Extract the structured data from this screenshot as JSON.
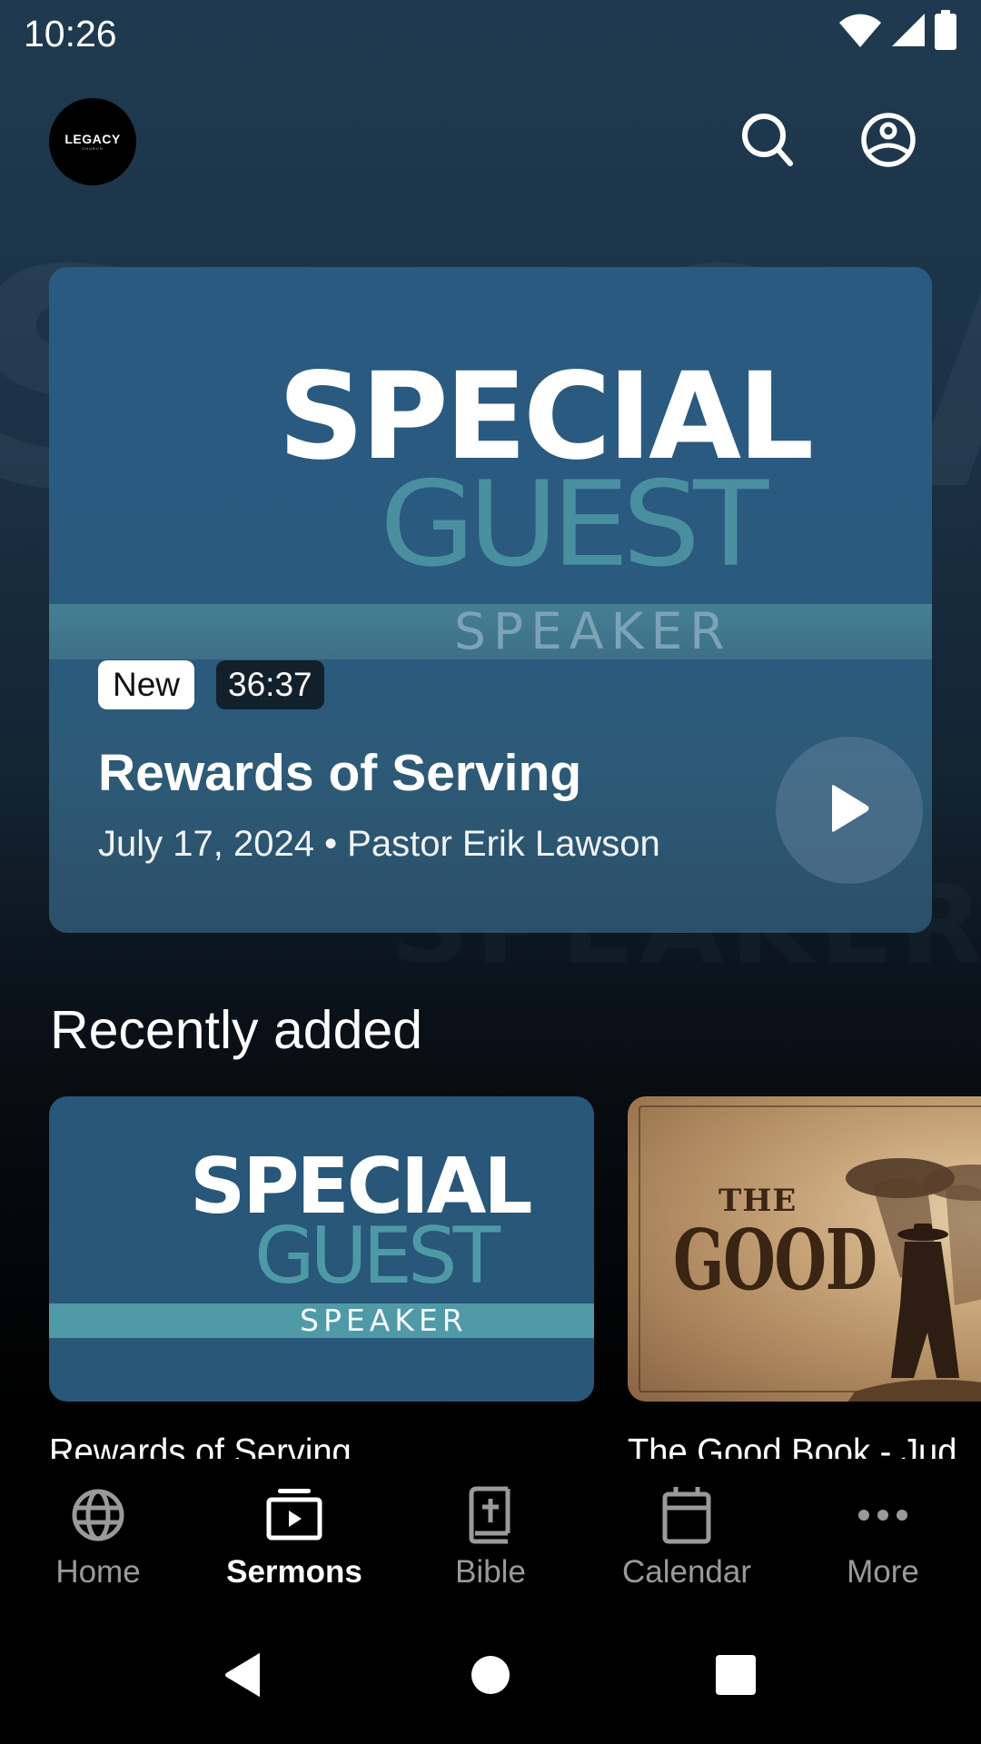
{
  "status_bar": {
    "time": "10:26",
    "icons": [
      "wifi-icon",
      "cellular-signal-icon",
      "battery-icon"
    ]
  },
  "header": {
    "logo": {
      "main": "LEGACY",
      "sub": "CHURCH"
    },
    "actions": [
      {
        "name": "search",
        "icon": "search-icon"
      },
      {
        "name": "profile",
        "icon": "account-circle-icon"
      }
    ]
  },
  "background_watermark": {
    "line1": "SPECIAL",
    "line2": "SPEAKER"
  },
  "featured": {
    "artwork": {
      "line1": "SPECIAL",
      "line2": "GUEST",
      "line3": "SPEAKER"
    },
    "badge_new": "New",
    "duration": "36:37",
    "title": "Rewards of Serving",
    "meta": "July 17, 2024 • Pastor Erik Lawson",
    "play_icon": "play-icon"
  },
  "recently_added": {
    "heading": "Recently added",
    "items": [
      {
        "title": "Rewards of Serving",
        "artwork": {
          "line1": "SPECIAL",
          "line2": "GUEST",
          "line3": "SPEAKER"
        }
      },
      {
        "title": "The Good Book - Jud",
        "artwork": {
          "line1": "THE",
          "line2": "GOOD"
        }
      }
    ]
  },
  "bottom_nav": {
    "active": "Sermons",
    "items": [
      {
        "label": "Home",
        "icon": "globe-icon"
      },
      {
        "label": "Sermons",
        "icon": "video-library-icon"
      },
      {
        "label": "Bible",
        "icon": "bible-icon"
      },
      {
        "label": "Calendar",
        "icon": "calendar-icon"
      },
      {
        "label": "More",
        "icon": "more-horizontal-icon"
      }
    ]
  },
  "system_nav": {
    "buttons": [
      "back-icon",
      "home-icon",
      "recents-icon"
    ]
  },
  "colors": {
    "card_blue": "#2a5a80",
    "teal_accent": "#4f9aa6",
    "nav_inactive": "#9a9a9a",
    "nav_active": "#ffffff"
  }
}
